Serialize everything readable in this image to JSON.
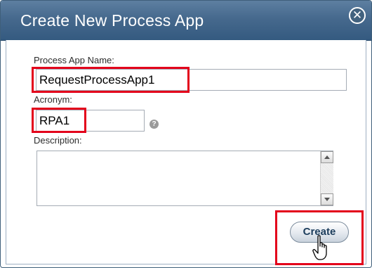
{
  "dialog": {
    "title": "Create New Process App",
    "close_symbol": "✕"
  },
  "form": {
    "name_label": "Process App Name:",
    "name_value": "RequestProcessApp1",
    "acronym_label": "Acronym:",
    "acronym_value": "RPA1",
    "help_symbol": "?",
    "description_label": "Description:",
    "description_value": ""
  },
  "actions": {
    "create_label": "Create"
  },
  "icons": {
    "close": "close-icon",
    "help": "help-icon",
    "cursor": "hand-pointer-icon",
    "scroll_up": "scroll-up-arrow-icon",
    "scroll_down": "scroll-down-arrow-icon"
  },
  "colors": {
    "titlebar": "#46698d",
    "highlight": "#e3001b",
    "button_text": "#1c3d5c"
  }
}
